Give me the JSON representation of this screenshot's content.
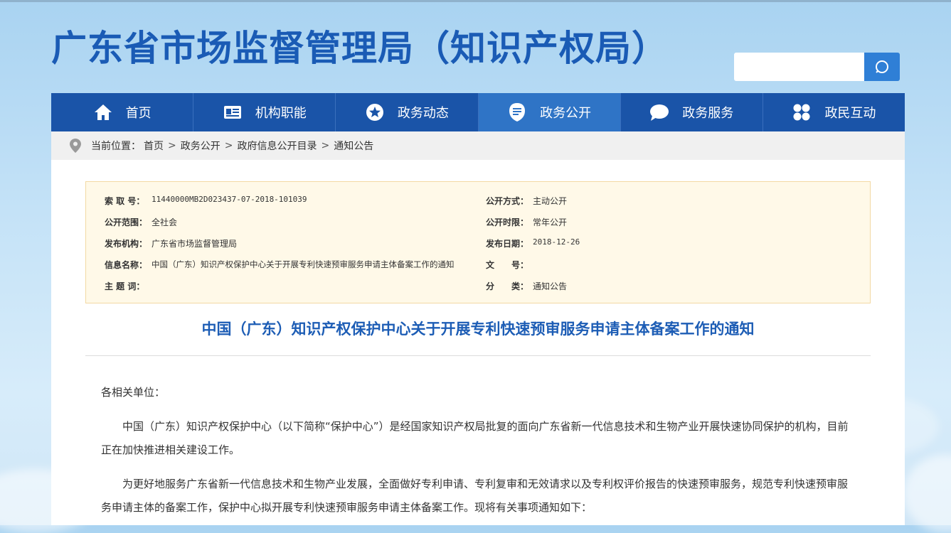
{
  "header": {
    "site_title": "广东省市场监督管理局（知识产权局）",
    "search": {
      "placeholder": ""
    }
  },
  "nav": {
    "items": [
      {
        "label": "首页",
        "icon": "home-icon"
      },
      {
        "label": "机构职能",
        "icon": "id-card-icon"
      },
      {
        "label": "政务动态",
        "icon": "star-icon"
      },
      {
        "label": "政务公开",
        "icon": "document-icon",
        "active": true
      },
      {
        "label": "政务服务",
        "icon": "chat-bubble-icon"
      },
      {
        "label": "政民互动",
        "icon": "grid-icon"
      }
    ]
  },
  "breadcrumb": {
    "prefix": "当前位置：",
    "items": [
      "首页",
      "政务公开",
      "政府信息公开目录",
      "通知公告"
    ],
    "separator": ">"
  },
  "info": {
    "index_no": {
      "label": "索 取 号：",
      "value": "11440000MB2D023437-07-2018-101039"
    },
    "scope": {
      "label": "公开范围：",
      "value": "全社会"
    },
    "issuer": {
      "label": "发布机构：",
      "value": "广东省市场监督管理局"
    },
    "name": {
      "label": "信息名称：",
      "value": "中国（广东）知识产权保护中心关于开展专利快速预审服务申请主体备案工作的通知"
    },
    "subject": {
      "label": "主 题 词：",
      "value": ""
    },
    "method": {
      "label": "公开方式：",
      "value": "主动公开"
    },
    "period": {
      "label": "公开时限：",
      "value": "常年公开"
    },
    "date": {
      "label": "发布日期：",
      "value": "2018-12-26"
    },
    "doc_no": {
      "label": "文　　号：",
      "value": ""
    },
    "category": {
      "label": "分　　类：",
      "value": "通知公告"
    }
  },
  "article": {
    "title": "中国（广东）知识产权保护中心关于开展专利快速预审服务申请主体备案工作的通知",
    "salutation": "各相关单位：",
    "p1": "　　中国（广东）知识产权保护中心（以下简称“保护中心”）是经国家知识产权局批复的面向广东省新一代信息技术和生物产业开展快速协同保护的机构，目前正在加快推进相关建设工作。",
    "p2": "　　为更好地服务广东省新一代信息技术和生物产业发展，全面做好专利申请、专利复审和无效请求以及专利权评价报告的快速预审服务，规范专利快速预审服务申请主体的备案工作，保护中心拟开展专利快速预审服务申请主体备案工作。现将有关事项通知如下："
  },
  "colors": {
    "brand_blue": "#1a5bb5",
    "nav_bg": "#1a54a8",
    "nav_active": "#2f74c6",
    "info_bg": "#fff9e8",
    "info_border": "#f3d9a4"
  }
}
